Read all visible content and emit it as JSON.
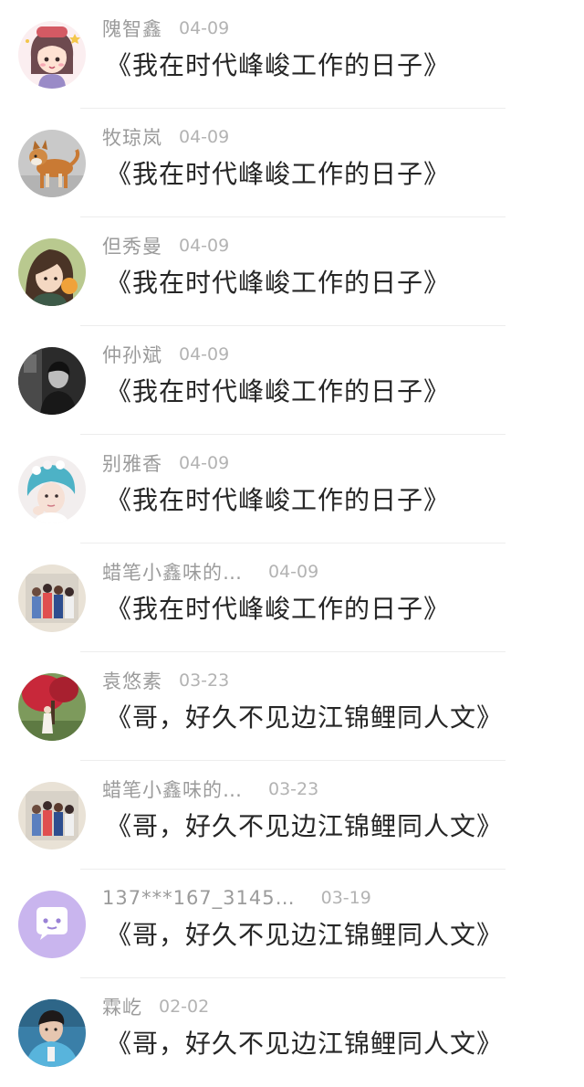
{
  "comments": [
    {
      "username": "隗智鑫",
      "date": "04-09",
      "message": "《我在时代峰峻工作的日子》",
      "avatar": "cartoon-girl-avatar"
    },
    {
      "username": "牧琼岚",
      "date": "04-09",
      "message": "《我在时代峰峻工作的日子》",
      "avatar": "dog-photo-avatar"
    },
    {
      "username": "但秀曼",
      "date": "04-09",
      "message": "《我在时代峰峻工作的日子》",
      "avatar": "anime-girl-avatar"
    },
    {
      "username": "仲孙斌",
      "date": "04-09",
      "message": "《我在时代峰峻工作的日子》",
      "avatar": "bw-portrait-avatar"
    },
    {
      "username": "别雅香",
      "date": "04-09",
      "message": "《我在时代峰峻工作的日子》",
      "avatar": "blue-hair-avatar"
    },
    {
      "username": "蜡笔小鑫味的…",
      "date": "04-09",
      "message": "《我在时代峰峻工作的日子》",
      "avatar": "group-photo-avatar"
    },
    {
      "username": "袁悠素",
      "date": "03-23",
      "message": "《哥，好久不见边江锦鲤同人文》",
      "avatar": "red-tree-avatar"
    },
    {
      "username": "蜡笔小鑫味的…",
      "date": "03-23",
      "message": "《哥，好久不见边江锦鲤同人文》",
      "avatar": "group-photo-avatar"
    },
    {
      "username": "137***167_3145…",
      "date": "03-19",
      "message": "《哥，好久不见边江锦鲤同人文》",
      "avatar": "chat-bubble-avatar"
    },
    {
      "username": "霖屹",
      "date": "02-02",
      "message": "《哥，好久不见边江锦鲤同人文》",
      "avatar": "blue-hoodie-avatar"
    }
  ]
}
